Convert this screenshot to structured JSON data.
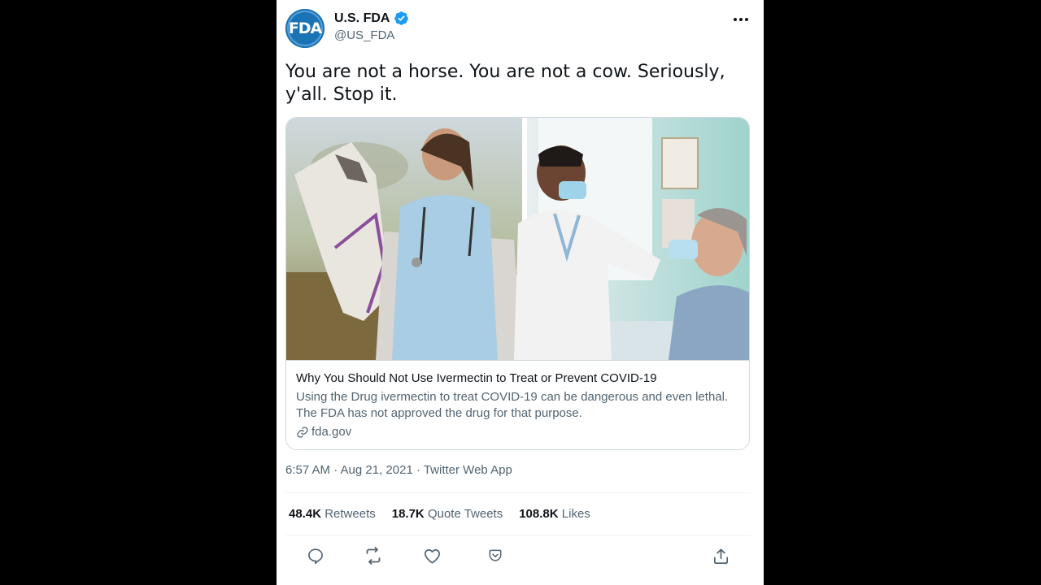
{
  "tweet": {
    "avatar_text": "FDA",
    "display_name": "U.S. FDA",
    "handle": "@US_FDA",
    "text": "You are not a horse. You are not a cow. Seriously, y'all. Stop it.",
    "timestamp": "6:57 AM · Aug 21, 2021 · Twitter Web App"
  },
  "card": {
    "title": "Why You Should Not Use Ivermectin to Treat or Prevent COVID-19",
    "description": "Using the Drug ivermectin to treat COVID-19 can be dangerous and even lethal. The FDA has not approved the drug for that purpose.",
    "domain": "fda.gov",
    "image_description": "veterinarian with a horse and doctor examining a masked patient"
  },
  "stats": {
    "retweets_count": "48.4K",
    "retweets_label": "Retweets",
    "quotes_count": "18.7K",
    "quotes_label": "Quote Tweets",
    "likes_count": "108.8K",
    "likes_label": "Likes"
  },
  "icons": [
    "verified-badge-icon",
    "more-icon",
    "link-icon",
    "reply-icon",
    "retweet-icon",
    "like-icon",
    "bookmark-icon",
    "share-icon"
  ],
  "colors": {
    "brand": "#1a73b5",
    "verified": "#1d9bf0",
    "text_primary": "#0f1419",
    "text_secondary": "#536471",
    "border": "#cfd9de",
    "background": "#000000"
  }
}
